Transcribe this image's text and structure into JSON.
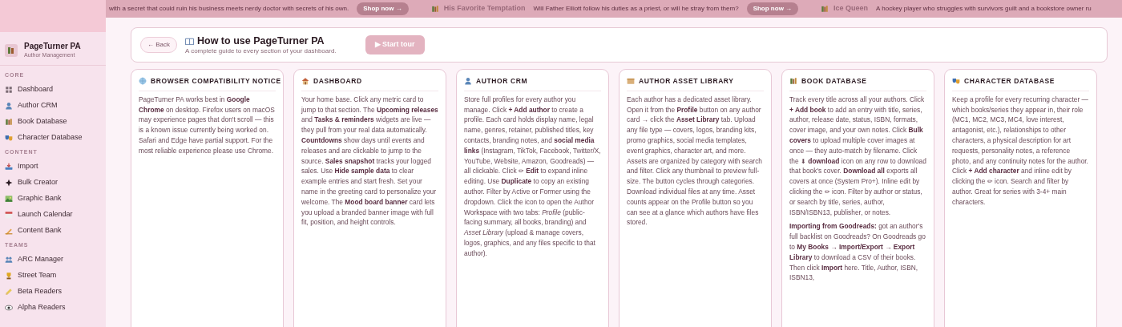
{
  "ticker": {
    "items": [
      {
        "kind": "blurb",
        "text": "with a secret that could ruin his business meets nerdy doctor with secrets of his own."
      },
      {
        "kind": "button",
        "text": "Shop now →"
      },
      {
        "kind": "title",
        "text": "His Favorite Temptation"
      },
      {
        "kind": "blurb",
        "text": "Will Father Elliott follow his duties as a priest, or will he stray from them?"
      },
      {
        "kind": "button",
        "text": "Shop now →"
      },
      {
        "kind": "title",
        "text": "Ice Queen"
      },
      {
        "kind": "blurb",
        "text": "A hockey player who struggles with survivors guilt and a bookstore owner ru"
      }
    ]
  },
  "sidebar": {
    "brand": {
      "name": "PageTurner PA",
      "subtitle": "Author Management"
    },
    "sections": [
      {
        "heading": "CORE",
        "items": [
          {
            "label": "Dashboard"
          },
          {
            "label": "Author CRM"
          },
          {
            "label": "Book Database"
          },
          {
            "label": "Character Database"
          }
        ]
      },
      {
        "heading": "CONTENT",
        "items": [
          {
            "label": "Import"
          },
          {
            "label": "Bulk Creator"
          },
          {
            "label": "Graphic Bank"
          },
          {
            "label": "Launch Calendar"
          },
          {
            "label": "Content Bank"
          }
        ]
      },
      {
        "heading": "TEAMS",
        "items": [
          {
            "label": "ARC Manager"
          },
          {
            "label": "Street Team"
          },
          {
            "label": "Beta Readers"
          },
          {
            "label": "Alpha Readers"
          }
        ]
      }
    ]
  },
  "header": {
    "back": "← Back",
    "title": "How to use PageTurner PA",
    "subtitle": "A complete guide to every section of your dashboard.",
    "start": "▶ Start tour"
  },
  "cards": [
    {
      "title": "BROWSER COMPATIBILITY NOTICE",
      "paragraphs": [
        "PageTurner PA works best in **Google Chrome** on desktop. Firefox users on macOS may experience pages that don't scroll — this is a known issue currently being worked on. Safari and Edge have partial support. For the most reliable experience please use Chrome."
      ]
    },
    {
      "title": "DASHBOARD",
      "paragraphs": [
        "Your home base. Click any metric card to jump to that section. The **Upcoming releases** and **Tasks & reminders** widgets are live — they pull from your real data automatically. **Countdowns** show days until events and releases and are clickable to jump to the source. **Sales snapshot** tracks your logged sales. Use **Hide sample data** to clear example entries and start fresh. Set your name in the greeting card to personalize your welcome. The **Mood board banner** card lets you upload a branded banner image with full fit, position, and height controls."
      ]
    },
    {
      "title": "AUTHOR CRM",
      "paragraphs": [
        "Store full profiles for every author you manage. Click **+ Add author** to create a profile. Each card holds display name, legal name, genres, retainer, published titles, key contacts, branding notes, and **social media links** (Instagram, TikTok, Facebook, Twitter/X, YouTube, Website, Amazon, Goodreads) — all clickable. Click ✏ **Edit** to expand inline editing. Use **Duplicate** to copy an existing author. Filter by Active or Former using the dropdown. Click the icon to open the Author Workspace with two tabs: *Profile* (public-facing summary, all books, branding) and *Asset Library* (upload & manage covers, logos, graphics, and any files specific to that author)."
      ]
    },
    {
      "title": "AUTHOR ASSET LIBRARY",
      "paragraphs": [
        "Each author has a dedicated asset library. Open it from the **Profile** button on any author card → click the **Asset Library** tab. Upload any file type — covers, logos, branding kits, promo graphics, social media templates, event graphics, character art, and more. Assets are organized by category with search and filter. Click any thumbnail to preview full-size. The button cycles through categories. Download individual files at any time. Asset counts appear on the Profile button so you can see at a glance which authors have files stored."
      ]
    },
    {
      "title": "BOOK DATABASE",
      "paragraphs": [
        "Track every title across all your authors. Click **+ Add book** to add an entry with title, series, author, release date, status, ISBN, formats, cover image, and your own notes. Click **Bulk covers** to upload multiple cover images at once — they auto-match by filename. Click the ⬇ **download** icon on any row to download that book's cover. **Download all** exports all covers at once (System Pro+). Inline edit by clicking the ✏ icon. Filter by author or status, or search by title, series, author, ISBN/ISBN13, publisher, or notes.",
        "**Importing from Goodreads:** got an author's full backlist on Goodreads? On Goodreads go to **My Books → Import/Export → Export Library** to download a CSV of their books. Then click **Import** here. Title, Author, ISBN, ISBN13,"
      ]
    },
    {
      "title": "CHARACTER DATABASE",
      "paragraphs": [
        "Keep a profile for every recurring character — which books/series they appear in, their role (MC1, MC2, MC3, MC4, love interest, antagonist, etc.), relationships to other characters, a physical description for art requests, personality notes, a reference photo, and any continuity notes for the author. Click **+ Add character** and inline edit by clicking the ✏ icon. Search and filter by author. Great for series with 3-4+ main characters."
      ]
    }
  ]
}
